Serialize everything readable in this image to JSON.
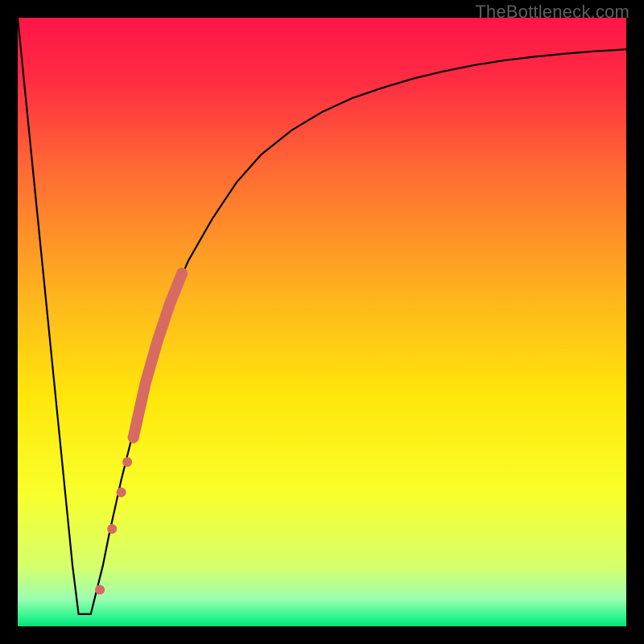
{
  "watermark": "TheBottleneck.com",
  "chart_data": {
    "type": "line",
    "title": "",
    "xlabel": "",
    "ylabel": "",
    "xlim": [
      0,
      100
    ],
    "ylim": [
      0,
      100
    ],
    "gradient_stops": [
      {
        "pos": 0.0,
        "color": "#ff1647"
      },
      {
        "pos": 0.1,
        "color": "#ff2b43"
      },
      {
        "pos": 0.25,
        "color": "#ff6a33"
      },
      {
        "pos": 0.45,
        "color": "#ffb21e"
      },
      {
        "pos": 0.62,
        "color": "#ffe60a"
      },
      {
        "pos": 0.78,
        "color": "#f9ff2a"
      },
      {
        "pos": 0.9,
        "color": "#d6ff6a"
      },
      {
        "pos": 0.955,
        "color": "#9cffb0"
      },
      {
        "pos": 0.985,
        "color": "#2bf58e"
      },
      {
        "pos": 1.0,
        "color": "#00e37b"
      }
    ],
    "series": [
      {
        "name": "bottleneck-curve",
        "x": [
          0.0,
          2.0,
          4.0,
          6.0,
          8.0,
          9.0,
          10.0,
          11.0,
          12.0,
          13.0,
          14.0,
          15.0,
          17.0,
          19.0,
          21.0,
          23.0,
          25.0,
          28.0,
          32.0,
          36.0,
          40.0,
          45.0,
          50.0,
          55.0,
          60.0,
          65.0,
          70.0,
          75.0,
          80.0,
          85.0,
          90.0,
          95.0,
          100.0
        ],
        "y": [
          100.0,
          80.0,
          60.0,
          40.0,
          20.0,
          10.0,
          2.0,
          2.0,
          2.0,
          6.0,
          10.0,
          15.0,
          24.0,
          32.0,
          40.0,
          47.0,
          53.0,
          60.0,
          67.0,
          73.0,
          77.5,
          81.5,
          84.5,
          86.8,
          88.5,
          90.0,
          91.2,
          92.2,
          93.0,
          93.6,
          94.1,
          94.5,
          94.8
        ]
      }
    ],
    "markers": [
      {
        "x": 13.5,
        "y": 6.0,
        "r": 6
      },
      {
        "x": 15.5,
        "y": 16.0,
        "r": 6
      },
      {
        "x": 17.0,
        "y": 22.0,
        "r": 6
      },
      {
        "x": 18.0,
        "y": 27.0,
        "r": 6
      }
    ],
    "thick_segment": {
      "x": [
        19.0,
        20.0,
        21.0,
        22.0,
        23.0,
        24.0,
        25.0,
        26.0,
        27.0
      ],
      "y": [
        31.0,
        35.5,
        40.0,
        43.5,
        47.0,
        50.0,
        53.0,
        55.5,
        58.0
      ]
    },
    "marker_color": "#d76a62",
    "curve_color": "#000000"
  }
}
